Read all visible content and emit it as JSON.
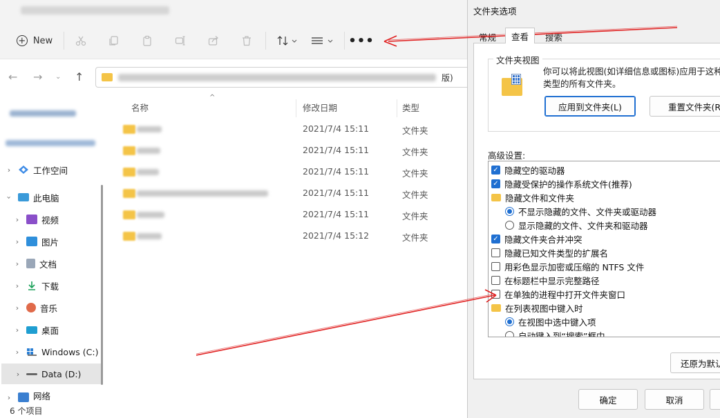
{
  "explorer": {
    "toolbar": {
      "new_label": "New",
      "more_label": "•••"
    },
    "address_tail": "版)",
    "sidebar": {
      "items": [
        {
          "label": "工作空间",
          "icon": "workspace-icon"
        },
        {
          "label": "此电脑",
          "icon": "computer-icon"
        },
        {
          "label": "视频",
          "icon": "video-icon"
        },
        {
          "label": "图片",
          "icon": "pictures-icon"
        },
        {
          "label": "文档",
          "icon": "documents-icon"
        },
        {
          "label": "下载",
          "icon": "download-icon"
        },
        {
          "label": "音乐",
          "icon": "music-icon"
        },
        {
          "label": "桌面",
          "icon": "desktop-icon"
        },
        {
          "label": "Windows (C:)",
          "icon": "drive-c-icon"
        },
        {
          "label": "Data (D:)",
          "icon": "drive-d-icon"
        },
        {
          "label": "网络",
          "icon": "network-icon"
        }
      ]
    },
    "columns": {
      "name": "名称",
      "date": "修改日期",
      "type": "类型"
    },
    "rows": [
      {
        "date": "2021/7/4 15:11",
        "type": "文件夹"
      },
      {
        "date": "2021/7/4 15:11",
        "type": "文件夹"
      },
      {
        "date": "2021/7/4 15:11",
        "type": "文件夹"
      },
      {
        "date": "2021/7/4 15:11",
        "type": "文件夹"
      },
      {
        "date": "2021/7/4 15:11",
        "type": "文件夹"
      },
      {
        "date": "2021/7/4 15:12",
        "type": "文件夹"
      }
    ],
    "status": "6 个项目"
  },
  "dialog": {
    "title": "文件夹选项",
    "tabs": [
      "常规",
      "查看",
      "搜索"
    ],
    "folder_view": {
      "label": "文件夹视图",
      "description": "你可以将此视图(如详细信息或图标)应用于这种类型的所有文件夹。",
      "apply_button": "应用到文件夹(L)",
      "reset_button": "重置文件夹(R)"
    },
    "advanced_label": "高级设置:",
    "advanced_items": [
      {
        "kind": "checkbox",
        "checked": true,
        "label": "隐藏空的驱动器"
      },
      {
        "kind": "checkbox",
        "checked": true,
        "label": "隐藏受保护的操作系统文件(推荐)"
      },
      {
        "kind": "folder",
        "label": "隐藏文件和文件夹"
      },
      {
        "kind": "radio",
        "checked": true,
        "label": "不显示隐藏的文件、文件夹或驱动器"
      },
      {
        "kind": "radio",
        "checked": false,
        "label": "显示隐藏的文件、文件夹和驱动器"
      },
      {
        "kind": "checkbox",
        "checked": true,
        "label": "隐藏文件夹合并冲突"
      },
      {
        "kind": "checkbox",
        "checked": false,
        "label": "隐藏已知文件类型的扩展名"
      },
      {
        "kind": "checkbox",
        "checked": false,
        "label": "用彩色显示加密或压缩的 NTFS 文件"
      },
      {
        "kind": "checkbox",
        "checked": false,
        "label": "在标题栏中显示完整路径"
      },
      {
        "kind": "checkbox",
        "checked": false,
        "label": "在单独的进程中打开文件夹窗口"
      },
      {
        "kind": "folder",
        "label": "在列表视图中键入时"
      },
      {
        "kind": "radio",
        "checked": true,
        "label": "在视图中选中键入项"
      },
      {
        "kind": "radio",
        "checked": false,
        "label": "自动键入到“搜索”框中"
      }
    ],
    "restore_button": "还原为默认值(D)",
    "ok_button": "确定",
    "cancel_button": "取消"
  },
  "colors": {
    "accent": "#1f6fd1",
    "folder": "#f4c447",
    "arrow": "#e02020"
  }
}
